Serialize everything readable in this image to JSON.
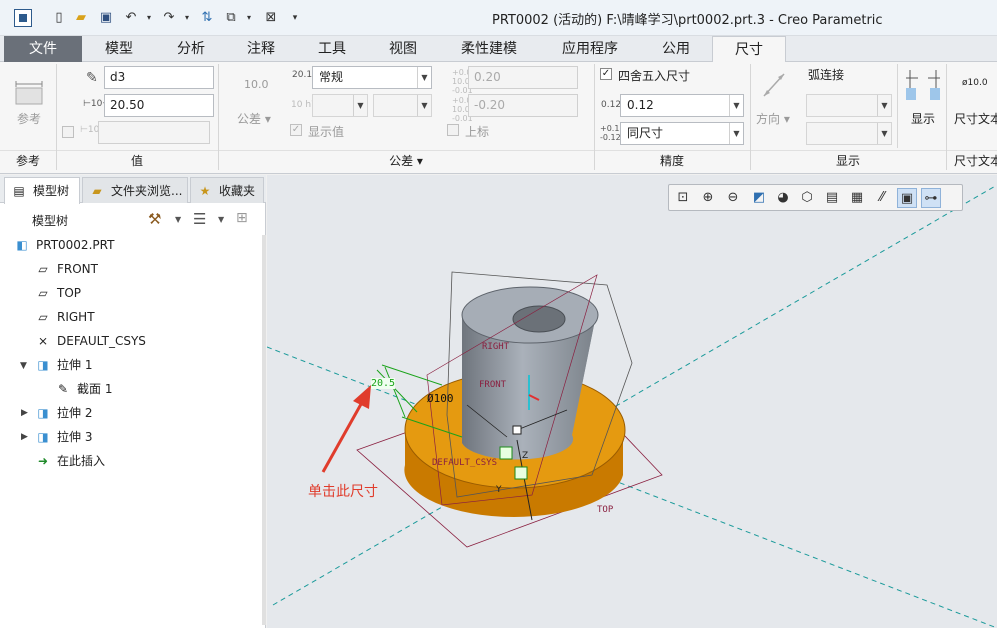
{
  "window": {
    "title": "PRT0002 (活动的) F:\\晴峰学习\\prt0002.prt.3 - Creo Parametric"
  },
  "menu": {
    "tabs": [
      "文件",
      "模型",
      "分析",
      "注释",
      "工具",
      "视图",
      "柔性建模",
      "应用程序",
      "公用",
      "尺寸"
    ]
  },
  "ribbon": {
    "ref_button": "参考",
    "ref_group": "参考",
    "name_value": "d3",
    "dim_value": "20.50",
    "value_group": "值",
    "tol_display_value": "10.0",
    "tol_label": "公差",
    "tol_mode": "常规",
    "tol_upper": "0.20",
    "tol_lower": "-0.20",
    "show_value": "显示值",
    "superscript": "上标",
    "tol_group": "公差",
    "tol_icon_top": "20.1",
    "tol_icon_h7": "10 h7",
    "round_label": "四舍五入尺寸",
    "round_checked": true,
    "decimals": "0.12",
    "dual": "同尺寸",
    "precision_group": "精度",
    "direction": "方向",
    "arc_connect": "弧连接",
    "display_button": "显示",
    "display_group": "显示",
    "dim_text": "尺寸文本",
    "dim_text_group": "尺寸文本",
    "dim_text_icon": "ø10.0"
  },
  "panel": {
    "tabs": [
      "模型树",
      "文件夹浏览...",
      "收藏夹"
    ],
    "header": "模型树",
    "tree": [
      {
        "label": "PRT0002.PRT",
        "icon": "part-icon",
        "level": 0
      },
      {
        "label": "FRONT",
        "icon": "datum-plane-icon",
        "level": 1
      },
      {
        "label": "TOP",
        "icon": "datum-plane-icon",
        "level": 1
      },
      {
        "label": "RIGHT",
        "icon": "datum-plane-icon",
        "level": 1
      },
      {
        "label": "DEFAULT_CSYS",
        "icon": "csys-icon",
        "level": 1
      },
      {
        "label": "拉伸 1",
        "icon": "extrude-icon",
        "level": 1,
        "expanded": true
      },
      {
        "label": "截面 1",
        "icon": "sketch-icon",
        "level": 2
      },
      {
        "label": "拉伸 2",
        "icon": "extrude-icon",
        "level": 1,
        "expanded": false
      },
      {
        "label": "拉伸 3",
        "icon": "extrude-icon",
        "level": 1,
        "expanded": false
      },
      {
        "label": "在此插入",
        "icon": "insert-arrow-icon",
        "level": 1
      }
    ]
  },
  "canvas": {
    "annotation": "单击此尺寸",
    "dim_selected": "20.5",
    "dim_diameter": "Ø100",
    "plane_labels": [
      "RIGHT",
      "FRONT",
      "DEFAULT_CSYS",
      "TOP"
    ],
    "axis_labels": [
      "Z",
      "Y"
    ],
    "colors": {
      "model": "#d88b00",
      "cylinder": "#8a9099",
      "annotation": "#e03c2c",
      "dimension": "#1aa31a",
      "datum": "#8a2040",
      "axis_line": "#1a9a9a"
    }
  }
}
